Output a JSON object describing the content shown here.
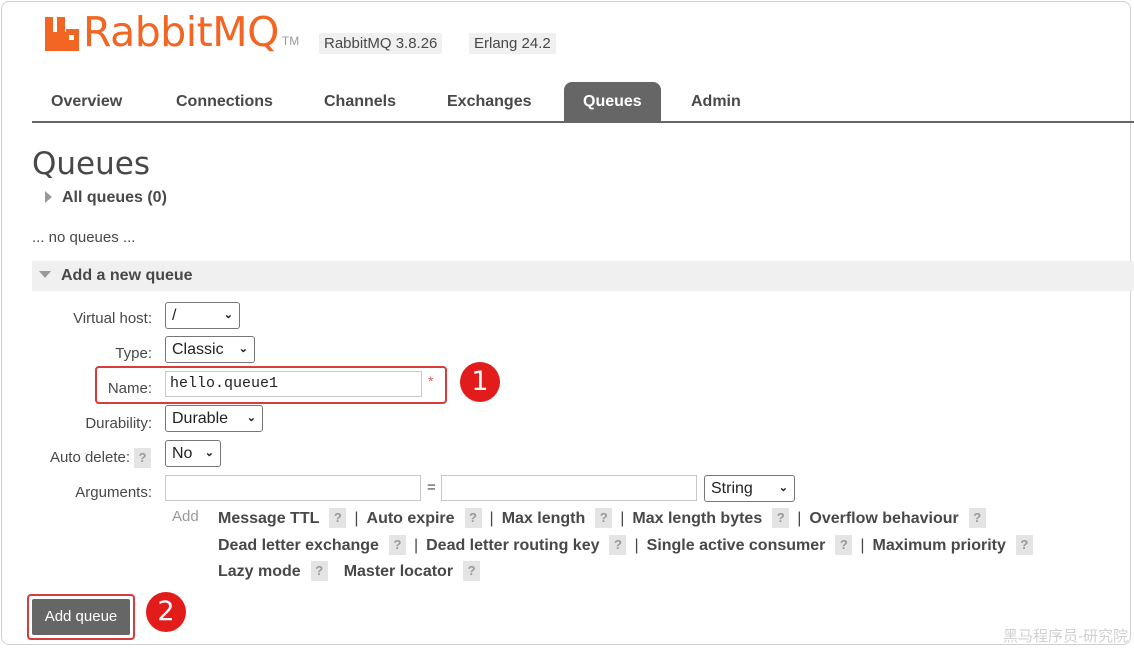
{
  "header": {
    "logo_text_main": "Rabbit",
    "logo_text_accent": "MQ",
    "logo_tm": "TM",
    "rabbitmq_version": "RabbitMQ 3.8.26",
    "erlang_version": "Erlang 24.2",
    "brand_color": "#f26522"
  },
  "tabs": [
    {
      "label": "Overview"
    },
    {
      "label": "Connections"
    },
    {
      "label": "Channels"
    },
    {
      "label": "Exchanges"
    },
    {
      "label": "Queues",
      "active": true
    },
    {
      "label": "Admin"
    }
  ],
  "page": {
    "title": "Queues",
    "all_queues": "All queues (0)",
    "no_queues": "... no queues ...",
    "add_section": "Add a new queue"
  },
  "form": {
    "virtual_host": {
      "label": "Virtual host:",
      "value": "/"
    },
    "type": {
      "label": "Type:",
      "value": "Classic"
    },
    "name": {
      "label": "Name:",
      "value": "hello.queue1",
      "required": "*"
    },
    "durability": {
      "label": "Durability:",
      "value": "Durable"
    },
    "auto_delete": {
      "label": "Auto delete:",
      "help": "?",
      "value": "No"
    },
    "arguments": {
      "label": "Arguments:",
      "key": "",
      "equals": "=",
      "value": "",
      "type": "String",
      "add": "Add"
    },
    "arg_links": {
      "message_ttl": "Message TTL",
      "auto_expire": "Auto expire",
      "max_length": "Max length",
      "max_length_bytes": "Max length bytes",
      "overflow_behaviour": "Overflow behaviour",
      "dead_letter_exchange": "Dead letter exchange",
      "dead_letter_routing_key": "Dead letter routing key",
      "single_active_consumer": "Single active consumer",
      "maximum_priority": "Maximum priority",
      "lazy_mode": "Lazy mode",
      "master_locator": "Master locator",
      "help": "?",
      "separator": "|"
    },
    "submit": "Add queue"
  },
  "annotations": {
    "badge1": "1",
    "badge2": "2",
    "highlight_color": "#d93a3a"
  },
  "watermark": "黑马程序员-研究院"
}
